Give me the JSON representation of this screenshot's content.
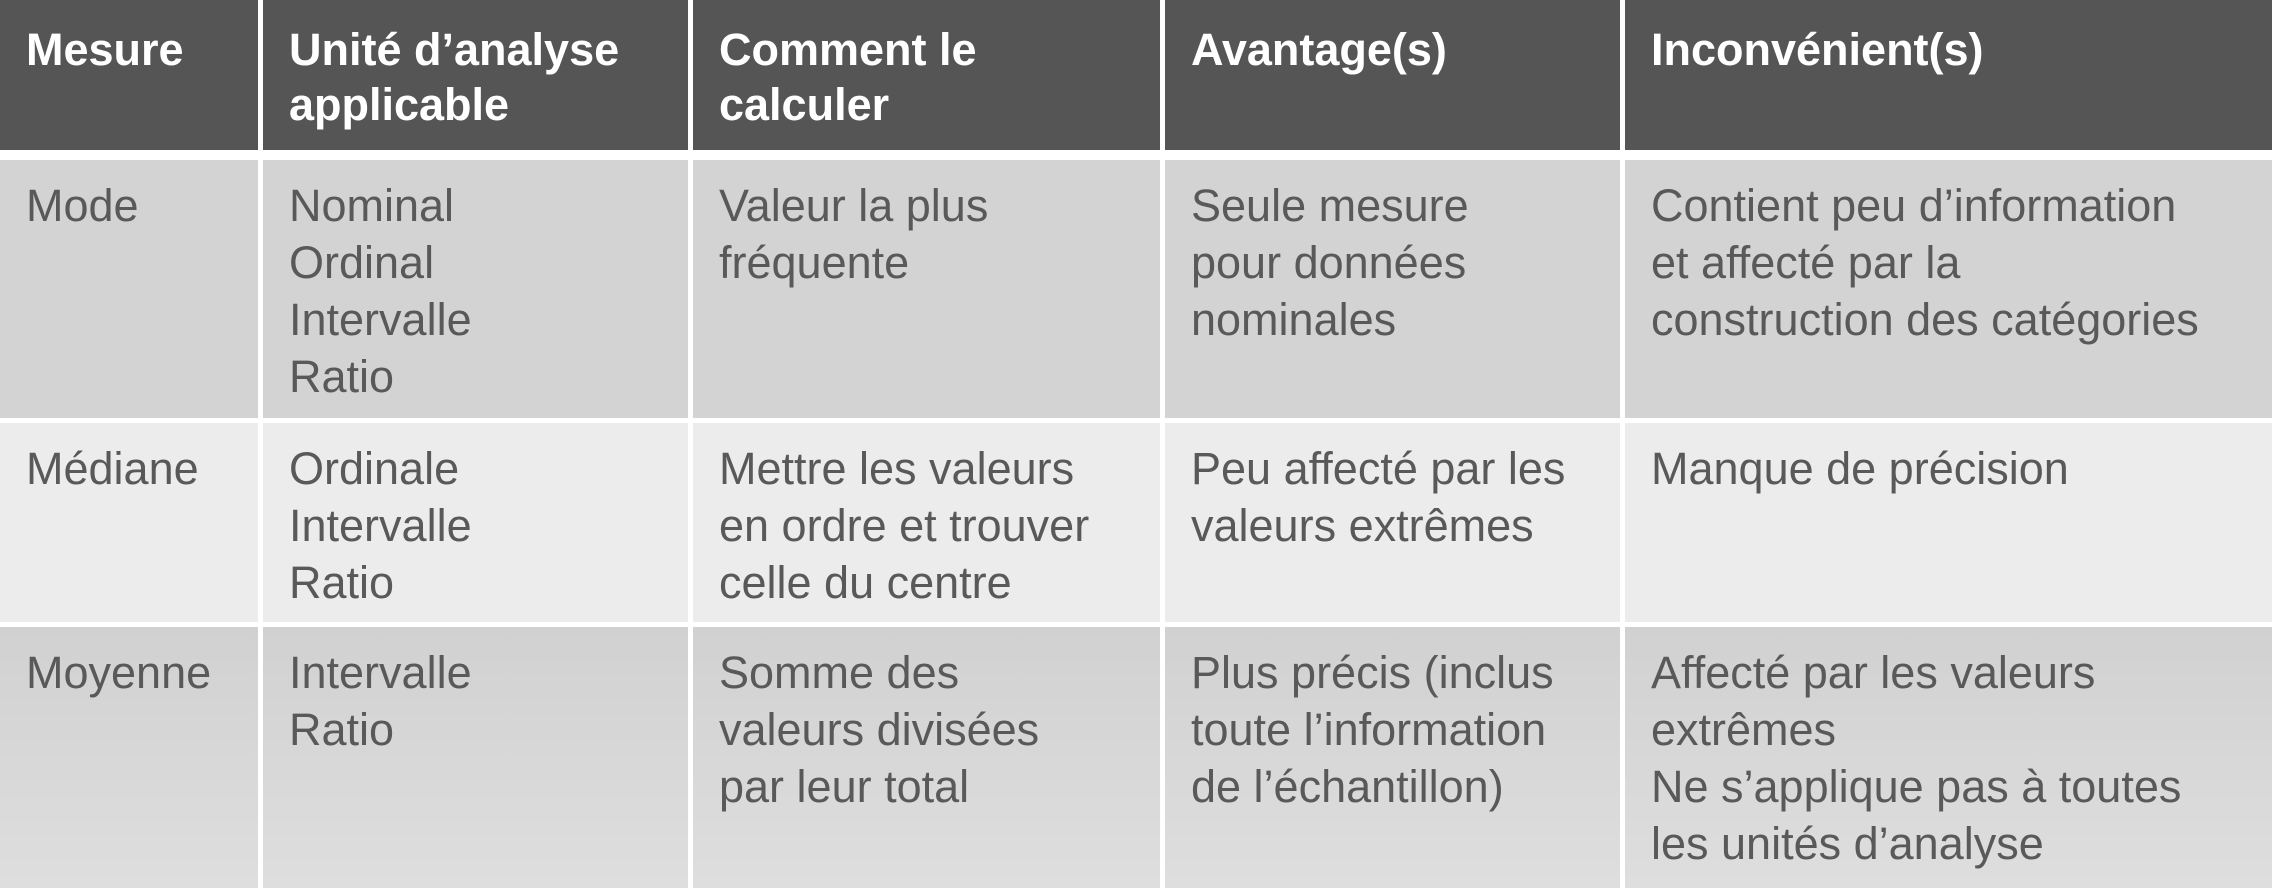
{
  "table": {
    "headers": [
      [
        "Mesure"
      ],
      [
        "Unité d’analyse",
        "applicable"
      ],
      [
        "Comment le",
        "calculer"
      ],
      [
        "Avantage(s)"
      ],
      [
        "Inconvénient(s)"
      ]
    ],
    "rows": [
      {
        "mesure": [
          "Mode"
        ],
        "unite": [
          "Nominal",
          "Ordinal",
          "Intervalle",
          "Ratio"
        ],
        "calcul": [
          "Valeur la plus",
          "fréquente"
        ],
        "avantages": [
          "Seule mesure",
          "pour données",
          "nominales"
        ],
        "inconvenients": [
          "Contient peu d’information",
          "et affecté par la",
          "construction des catégories"
        ]
      },
      {
        "mesure": [
          "Médiane"
        ],
        "unite": [
          "Ordinale",
          "Intervalle",
          "Ratio"
        ],
        "calcul": [
          "Mettre les valeurs",
          "en ordre et trouver",
          "celle du centre"
        ],
        "avantages": [
          "Peu affecté par les",
          "valeurs extrêmes"
        ],
        "inconvenients": [
          "Manque de précision"
        ]
      },
      {
        "mesure": [
          "Moyenne"
        ],
        "unite": [
          "Intervalle",
          "Ratio"
        ],
        "calcul": [
          "Somme des",
          "valeurs divisées",
          "par leur total"
        ],
        "avantages": [
          "Plus précis (inclus",
          "toute l’information",
          "de l’échantillon)"
        ],
        "inconvenients": [
          "Affecté par les valeurs",
          "extrêmes",
          "Ne s’applique pas à toutes",
          "les unités d’analyse"
        ]
      }
    ]
  },
  "colors": {
    "header_bg": "#555555",
    "header_text": "#ffffff",
    "row_dark_bg": "#d3d3d3",
    "row_light_bg": "#ececec",
    "cell_text": "#595959"
  }
}
